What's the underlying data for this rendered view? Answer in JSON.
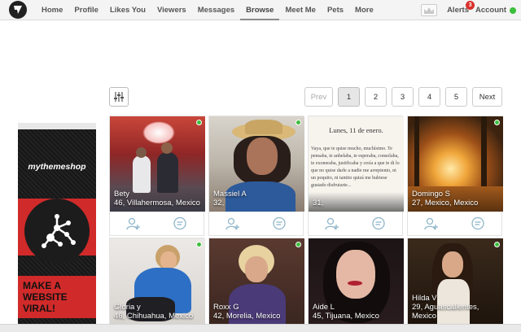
{
  "nav": {
    "items": [
      "Home",
      "Profile",
      "Likes You",
      "Viewers",
      "Messages",
      "Browse",
      "Meet Me",
      "Pets",
      "More"
    ],
    "active_index": 5,
    "alerts_label": "Alerts",
    "alerts_count": "3",
    "account_label": "Account"
  },
  "pager": {
    "prev_label": "Prev",
    "pages": [
      "1",
      "2",
      "3",
      "4",
      "5"
    ],
    "current_index": 0,
    "next_label": "Next"
  },
  "ad": {
    "brand": "mythemeshop",
    "slogan": "MAKE A WEBSITE VIRAL!"
  },
  "letter_card": {
    "date": "Lunes, 11 de enero.",
    "text": "Vaya, que te quise mucho, muchísimo. Te pensaba, te anhelaba, te esperaba, consolaba, te exoneraba, justificaba y creía a que te di lo que no quise darle a nadie me arrepiento, ni un poquito, ni tantito quizá me hubiese gustado disfrutarte..."
  },
  "profiles": [
    {
      "name": "Bety",
      "detail": "46, Villahermosa, Mexico"
    },
    {
      "name": "Massiel A",
      "detail": "32,"
    },
    {
      "name": "",
      "detail": "31,"
    },
    {
      "name": "Domingo S",
      "detail": "27, Mexico, Mexico"
    },
    {
      "name": "Gloria y",
      "detail": "46, Chihuahua, Mexico"
    },
    {
      "name": "Roxx G",
      "detail": "42, Morelia, Mexico"
    },
    {
      "name": "Aide L",
      "detail": "45, Tijuana, Mexico"
    },
    {
      "name": "Hilda V",
      "detail": "29, Aguascalientes, Mexico"
    }
  ]
}
